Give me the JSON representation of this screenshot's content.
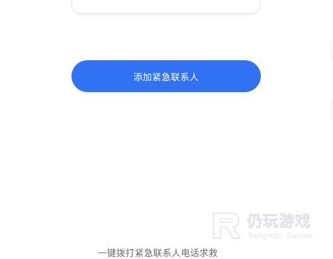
{
  "main": {
    "add_contact_label": "添加紧急联系人",
    "bottom_caption": "一键拨打紧急联系人电话求救"
  },
  "watermark": {
    "title": "仍玩游戏",
    "subtitle": "Rengwan Games"
  },
  "colors": {
    "accent": "#3172f5",
    "background": "#ffffff",
    "caption_text": "#6b6b6b"
  }
}
